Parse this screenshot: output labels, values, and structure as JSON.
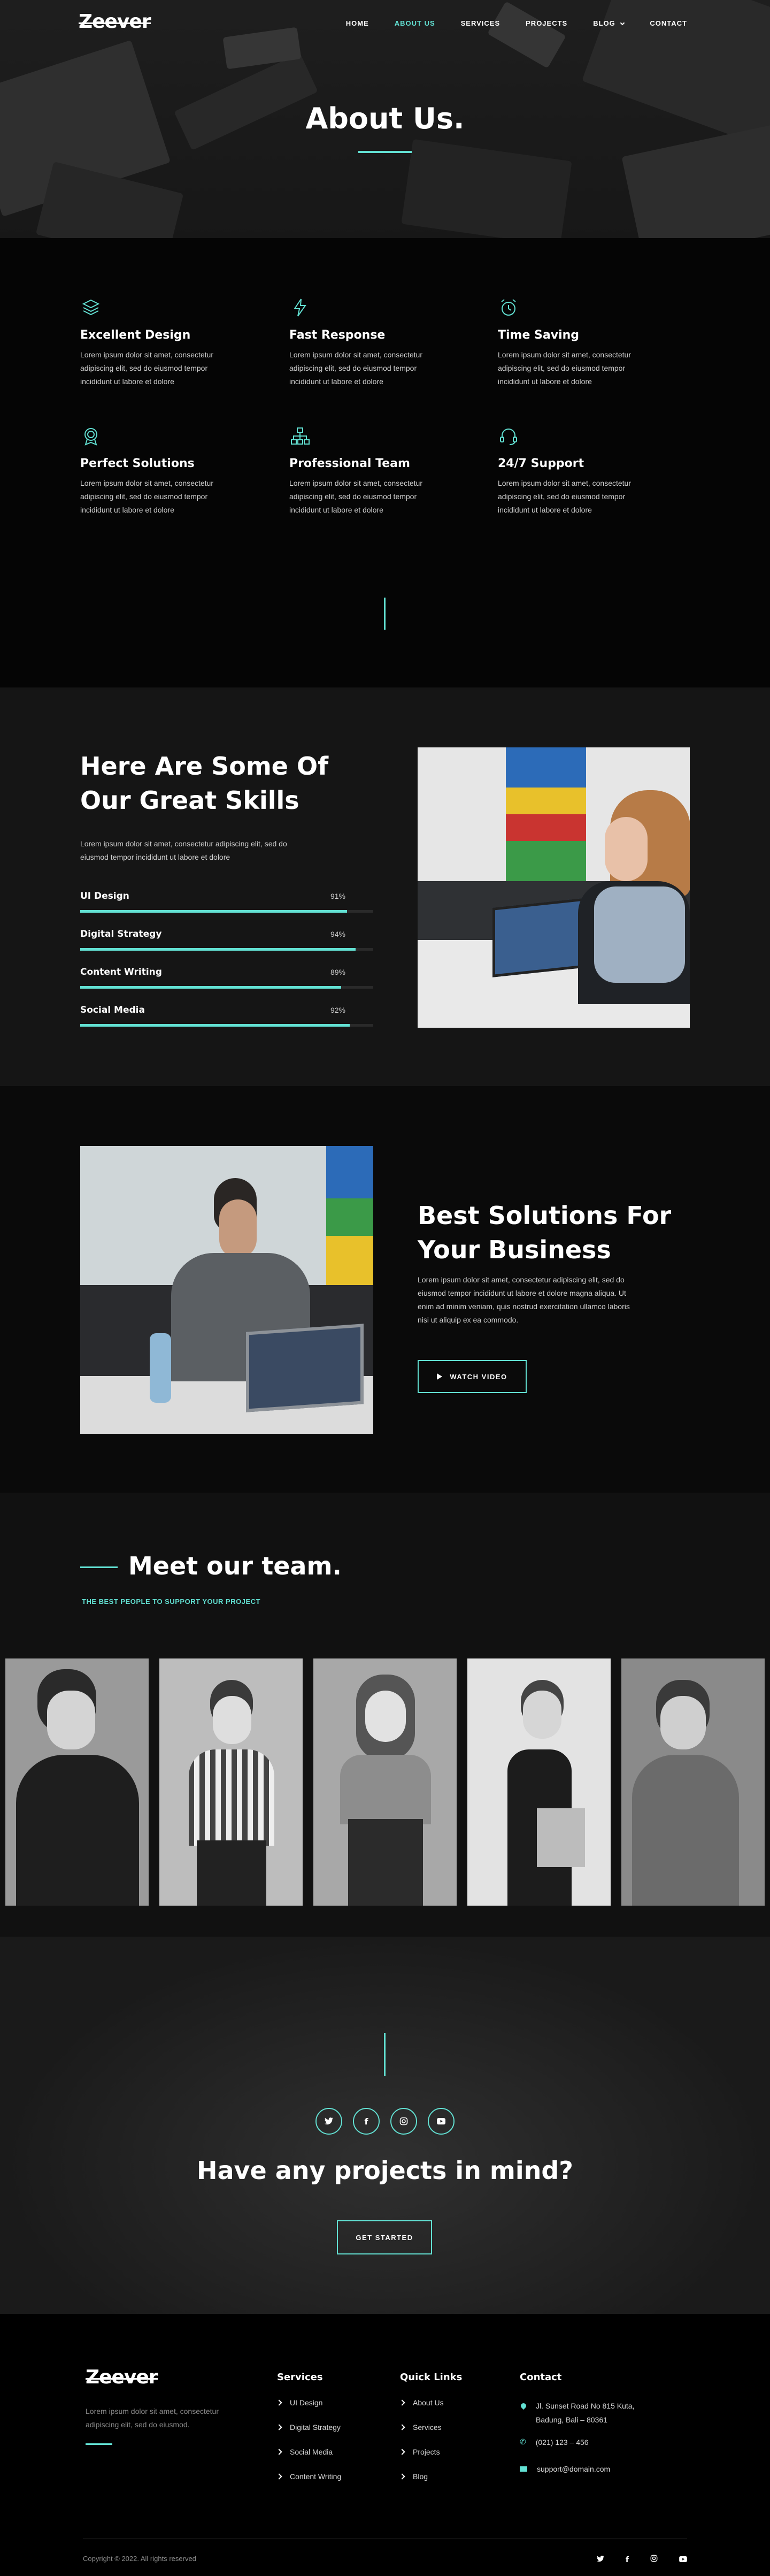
{
  "brand": {
    "logo": "Zeever"
  },
  "nav": {
    "items": [
      {
        "label": "HOME",
        "active": false
      },
      {
        "label": "ABOUT US",
        "active": true
      },
      {
        "label": "SERVICES",
        "active": false
      },
      {
        "label": "PROJECTS",
        "active": false
      },
      {
        "label": "BLOG",
        "active": false
      },
      {
        "label": "CONTACT",
        "active": false
      }
    ]
  },
  "hero": {
    "title": "About Us."
  },
  "features": [
    {
      "icon": "layers-icon",
      "title": "Excellent Design",
      "text": "Lorem ipsum dolor sit amet, consectetur adipiscing elit, sed do eiusmod tempor incididunt ut labore et dolore"
    },
    {
      "icon": "lightning-icon",
      "title": "Fast Response",
      "text": "Lorem ipsum dolor sit amet, consectetur adipiscing elit, sed do eiusmod tempor incididunt ut labore et dolore"
    },
    {
      "icon": "alarm-clock-icon",
      "title": "Time Saving",
      "text": "Lorem ipsum dolor sit amet, consectetur adipiscing elit, sed do eiusmod tempor incididunt ut labore et dolore"
    },
    {
      "icon": "award-badge-icon",
      "title": "Perfect Solutions",
      "text": "Lorem ipsum dolor sit amet, consectetur adipiscing elit, sed do eiusmod tempor incididunt ut labore et dolore"
    },
    {
      "icon": "team-network-icon",
      "title": "Professional Team",
      "text": "Lorem ipsum dolor sit amet, consectetur adipiscing elit, sed do eiusmod tempor incididunt ut labore et dolore"
    },
    {
      "icon": "headset-icon",
      "title": "24/7 Support",
      "text": "Lorem ipsum dolor sit amet, consectetur adipiscing elit, sed do eiusmod tempor incididunt ut labore et dolore"
    }
  ],
  "skills": {
    "title_line1": "Here Are Some Of",
    "title_line2": "Our Great Skills",
    "text": "Lorem ipsum dolor sit amet, consectetur adipiscing elit, sed do eiusmod tempor incididunt ut labore et dolore",
    "items": [
      {
        "name": "UI Design",
        "percent_label": "91%",
        "value": 91
      },
      {
        "name": "Digital Strategy",
        "percent_label": "94%",
        "value": 94
      },
      {
        "name": "Content Writing",
        "percent_label": "89%",
        "value": 89
      },
      {
        "name": "Social Media",
        "percent_label": "92%",
        "value": 92
      }
    ]
  },
  "solutions": {
    "title_line1": "Best Solutions For",
    "title_line2": "Your Business",
    "text": "Lorem ipsum dolor sit amet, consectetur adipiscing elit, sed do eiusmod tempor incididunt ut labore et dolore magna aliqua. Ut enim ad minim veniam, quis nostrud exercitation ullamco laboris nisi ut aliquip ex ea commodo.",
    "button": "WATCH VIDEO"
  },
  "team": {
    "title": "Meet our team.",
    "subtitle": "THE BEST PEOPLE TO SUPPORT YOUR PROJECT"
  },
  "cta": {
    "title": "Have any projects in mind?",
    "button": "GET STARTED",
    "social": [
      "twitter-icon",
      "facebook-icon",
      "instagram-icon",
      "youtube-icon"
    ]
  },
  "footer": {
    "logo": "Zeever",
    "about": "Lorem ipsum dolor sit amet, consectetur adipiscing elit, sed do eiusmod.",
    "services_title": "Services",
    "services": [
      "UI Design",
      "Digital Strategy",
      "Social Media",
      "Content Writing"
    ],
    "links_title": "Quick Links",
    "links": [
      "About Us",
      "Services",
      "Projects",
      "Blog"
    ],
    "contact_title": "Contact",
    "address_line1": "Jl. Sunset Road No 815 Kuta,",
    "address_line2": "Badung, Bali – 80361",
    "phone": "(021) 123 – 456",
    "email": "support@domain.com",
    "copyright": "Copyright © 2022. All rights reserved"
  },
  "colors": {
    "accent": "#62e0d2",
    "background": "#0b0b0b"
  }
}
